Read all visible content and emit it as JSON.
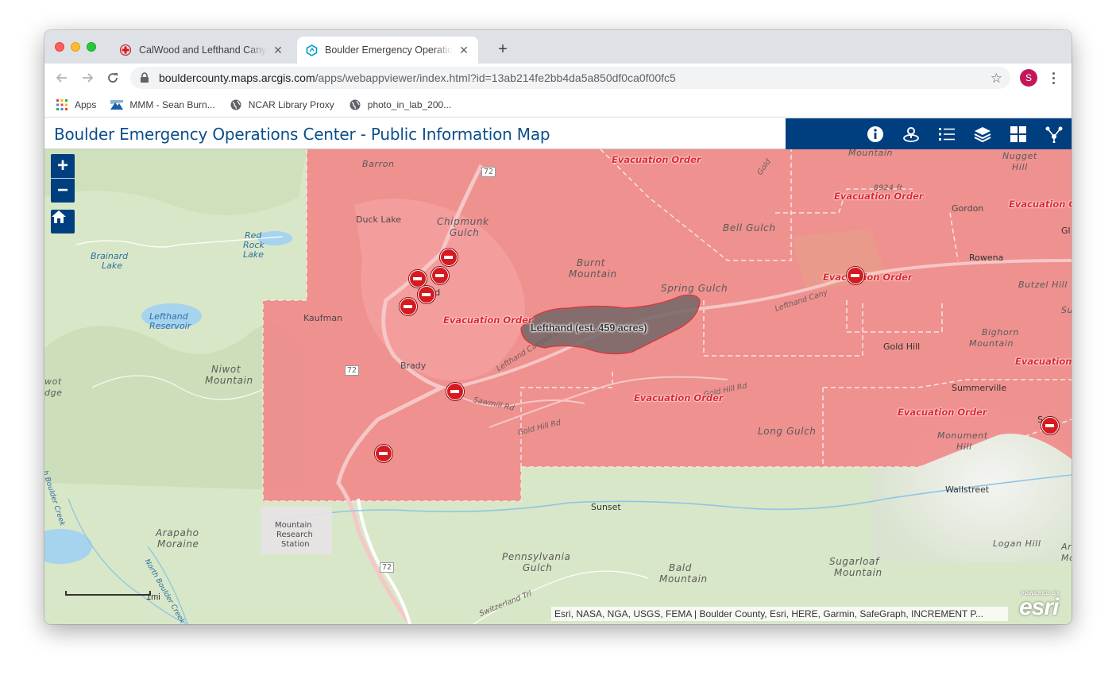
{
  "browser": {
    "tabs": [
      {
        "title": "CalWood and Lefthand Canyon Fires",
        "active": false
      },
      {
        "title": "Boulder Emergency Operations Center",
        "active": true
      }
    ],
    "url_host": "bouldercounty.maps.arcgis.com",
    "url_path": "/apps/webappviewer/index.html?id=13ab214fe2bb4da5a850df0ca0f00fc5",
    "profile_initial": "S",
    "bookmarks": [
      "Apps",
      "MMM - Sean Burn...",
      "NCAR Library Proxy",
      "photo_in_lab_200..."
    ]
  },
  "app": {
    "title": "Boulder Emergency Operations Center - Public Information Map",
    "widgets": [
      "about-icon",
      "locate-icon",
      "legend-icon",
      "layers-icon",
      "basemap-gallery-icon",
      "share-icon"
    ]
  },
  "map": {
    "zoom_in": "+",
    "zoom_out": "−",
    "scale_label": "1mi",
    "fire_label": "Lefthand (est. 459 acres)",
    "evac_label": "Evacuation Order",
    "evac_labels": [
      {
        "text": "Evacuation Order"
      },
      {
        "text": "Evacuation Order"
      },
      {
        "text": "Evacuation Or"
      },
      {
        "text": "Evacuation Order"
      },
      {
        "text": "Evacuation Order"
      },
      {
        "text": "Evacuation Order"
      },
      {
        "text": "Evacuation Order"
      },
      {
        "text": "Evacuation O"
      }
    ],
    "places": {
      "barron": "Barron",
      "duck_lake": "Duck Lake",
      "chipmunk_gulch_1": "Chipmunk",
      "chipmunk_gulch_2": "Gulch",
      "ward": "Ward",
      "kaufman": "Kaufman",
      "brady": "Brady",
      "burnt_mtn_1": "Burnt",
      "burnt_mtn_2": "Mountain",
      "spring_gulch": "Spring Gulch",
      "bell_gulch": "Bell Gulch",
      "mountain_top": "Mountain",
      "nugget_hill_1": "Nugget",
      "nugget_hill_2": "Hill",
      "elev": "8924 ft",
      "gordon": "Gordon",
      "rowena": "Rowena",
      "gl": "Gl",
      "butzel_hill": "Butzel Hill",
      "su": "Su",
      "bighorn_1": "Bighorn",
      "bighorn_2": "Mountain",
      "gold_hill": "Gold Hill",
      "summerville": "Summerville",
      "monument_1": "Monument",
      "monument_2": "Hill",
      "sali": "Sali",
      "wallstreet": "Wallstreet",
      "logan_hill": "Logan Hill",
      "ar": "Ar",
      "mo": "Mo",
      "long_gulch": "Long Gulch",
      "sunset": "Sunset",
      "mrs_1": "Mountain",
      "mrs_2": "Research",
      "mrs_3": "Station",
      "penn_1": "Pennsylvania",
      "penn_2": "Gulch",
      "bald_1": "Bald",
      "bald_2": "Mountain",
      "sugar_1": "Sugarloaf",
      "sugar_2": "Mountain",
      "arapaho_1": "Arapaho",
      "arapaho_2": "Moraine",
      "niwot_1": "Niwot",
      "niwot_2": "Mountain",
      "wot_1": "wot",
      "wot_2": "dge",
      "red_rock_1": "Red",
      "red_rock_2": "Rock",
      "red_rock_3": "Lake",
      "brainard_1": "Brainard",
      "brainard_2": "Lake",
      "lefthand_res_1": "Lefthand",
      "lefthand_res_2": "Reservoir",
      "hwy72_a": "72",
      "hwy72_b": "72",
      "hwy72_c": "72",
      "lefthand_canyon_dr": "Lefthand Canyon Dr",
      "lefthand_canyon_2": "Lefthand Cany",
      "sawmill_rd": "Sawmill Rd",
      "gold_hill_rd": "Gold Hill Rd",
      "gold_hill_rd_2": "Gold Hill Rd",
      "gold_rd": "Gold",
      "n_boulder_creek": "North Boulder Creek",
      "boulder_creek": "h Boulder Creek",
      "switzerland_trl": "Switzerland Trl"
    },
    "attribution": "Esri, NASA, NGA, USGS, FEMA | Boulder County, Esri, HERE, Garmin, SafeGraph, INCREMENT P...",
    "esri_powered": "POWERED BY",
    "esri_word": "esri",
    "colors": {
      "evac_fill": "#f08a8a",
      "fire_fill": "#7a6a6a",
      "header_bar": "#003f7f",
      "title_text": "#0b4f8a"
    }
  }
}
